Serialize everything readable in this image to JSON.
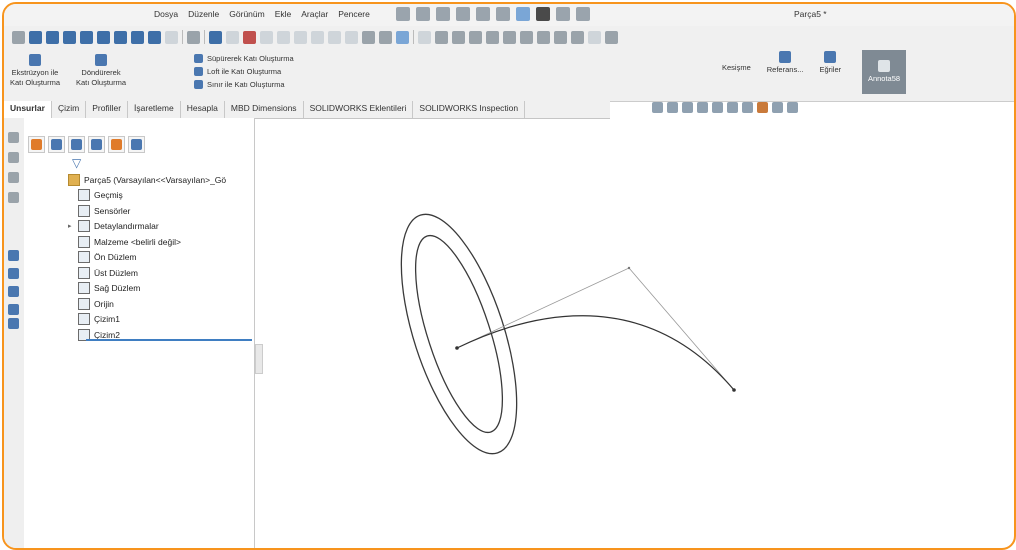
{
  "menu": {
    "items": [
      "Dosya",
      "Düzenle",
      "Görünüm",
      "Ekle",
      "Araçlar",
      "Pencere"
    ],
    "document_title": "Parça5 *"
  },
  "ribbon": {
    "extrude": [
      "Ekstrüzyon ile",
      "Katı Oluşturma"
    ],
    "revolve": [
      "Döndürerek",
      "Katı Oluşturma"
    ],
    "sweep": "Süpürerek Katı Oluşturma",
    "loft": "Loft ile Katı Oluşturma",
    "boundary": "Sınır ile Katı Oluşturma",
    "intersect": "Kesişme",
    "reference": "Referans...",
    "curves": "Eğriler",
    "annotation": "Annota58"
  },
  "tabs": [
    {
      "label": "Unsurlar",
      "active": true
    },
    {
      "label": "Çizim"
    },
    {
      "label": "Profiller"
    },
    {
      "label": "İşaretleme"
    },
    {
      "label": "Hesapla"
    },
    {
      "label": "MBD Dimensions"
    },
    {
      "label": "SOLIDWORKS Eklentileri"
    },
    {
      "label": "SOLIDWORKS Inspection"
    }
  ],
  "tree": {
    "root": "Parça5 (Varsayılan<<Varsayılan>_Gö",
    "items": [
      {
        "label": "Geçmiş",
        "icon": "history-icon"
      },
      {
        "label": "Sensörler",
        "icon": "sensor-icon"
      },
      {
        "label": "Detaylandırmalar",
        "icon": "annotations-icon",
        "expandable": true
      },
      {
        "label": "Malzeme <belirli değil>",
        "icon": "material-icon"
      },
      {
        "label": "Ön Düzlem",
        "icon": "plane-icon"
      },
      {
        "label": "Üst Düzlem",
        "icon": "plane-icon"
      },
      {
        "label": "Sağ Düzlem",
        "icon": "plane-icon"
      },
      {
        "label": "Orijin",
        "icon": "origin-icon"
      },
      {
        "label": "Çizim1",
        "icon": "sketch-icon"
      },
      {
        "label": "Çizim2",
        "icon": "sketch-icon"
      }
    ]
  },
  "colors": {
    "frame_accent": "#f7941d",
    "tree_active_bar": "#3f7ec2"
  }
}
